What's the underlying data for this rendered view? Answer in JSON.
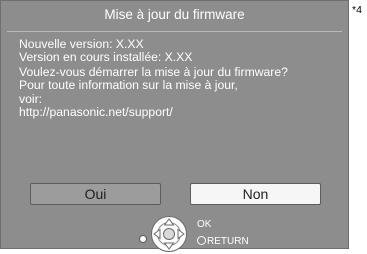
{
  "dialog": {
    "title": "Mise à jour du firmware",
    "lines": [
      "Nouvelle version:  X.XX",
      "Version en cours installée:  X.XX",
      "Voulez-vous démarrer la mise à jour du firmware?",
      "Pour toute information sur la mise à jour,",
      "voir:",
      "http://panasonic.net/support/"
    ],
    "buttons": {
      "yes": "Oui",
      "no": "Non"
    },
    "selected_button": "no"
  },
  "guide": {
    "ok": "OK",
    "return": "RETURN"
  },
  "footnote": "*4",
  "colors": {
    "panel": "#8d8d8d",
    "text": "#ffffff",
    "button_selected": "#f6f6f6",
    "button_unselected": "#9c9c9c"
  }
}
